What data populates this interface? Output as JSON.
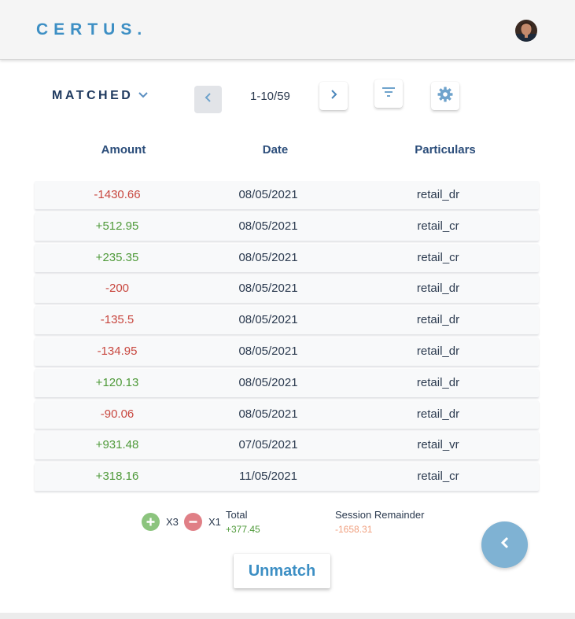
{
  "header": {
    "logo": "CERTUS.",
    "avatar_icon": "user-avatar"
  },
  "toolbar": {
    "status_label": "MATCHED",
    "page_indicator": "1-10/59",
    "icons": {
      "prev": "chevron-left-icon",
      "next": "chevron-right-icon",
      "filter": "filter-icon",
      "settings": "gear-icon",
      "dropdown": "chevron-down-icon"
    }
  },
  "table": {
    "headers": {
      "amount": "Amount",
      "date": "Date",
      "particulars": "Particulars"
    },
    "rows": [
      {
        "amount": "-1430.66",
        "date": "08/05/2021",
        "particulars": "retail_dr",
        "sign": "neg"
      },
      {
        "amount": "+512.95",
        "date": "08/05/2021",
        "particulars": "retail_cr",
        "sign": "pos"
      },
      {
        "amount": "+235.35",
        "date": "08/05/2021",
        "particulars": "retail_cr",
        "sign": "pos"
      },
      {
        "amount": "-200",
        "date": "08/05/2021",
        "particulars": "retail_dr",
        "sign": "neg"
      },
      {
        "amount": "-135.5",
        "date": "08/05/2021",
        "particulars": "retail_dr",
        "sign": "neg"
      },
      {
        "amount": "-134.95",
        "date": "08/05/2021",
        "particulars": "retail_dr",
        "sign": "neg"
      },
      {
        "amount": "+120.13",
        "date": "08/05/2021",
        "particulars": "retail_dr",
        "sign": "pos"
      },
      {
        "amount": "-90.06",
        "date": "08/05/2021",
        "particulars": "retail_dr",
        "sign": "neg"
      },
      {
        "amount": "+931.48",
        "date": "07/05/2021",
        "particulars": "retail_vr",
        "sign": "pos"
      },
      {
        "amount": "+318.16",
        "date": "11/05/2021",
        "particulars": "retail_cr",
        "sign": "pos"
      }
    ]
  },
  "summary": {
    "plus_count": "X3",
    "minus_count": "X1",
    "total_label": "Total",
    "total_value": "+377.45",
    "remainder_label": "Session Remainder",
    "remainder_value": "-1658.31"
  },
  "actions": {
    "unmatch_label": "Unmatch",
    "fab_icon": "chevron-left-icon"
  },
  "colors": {
    "brand": "#3d8fc4",
    "negative": "#c8473f",
    "positive": "#4f9a3a",
    "fab": "#7fb2d3",
    "remainder": "#f0a07f"
  }
}
